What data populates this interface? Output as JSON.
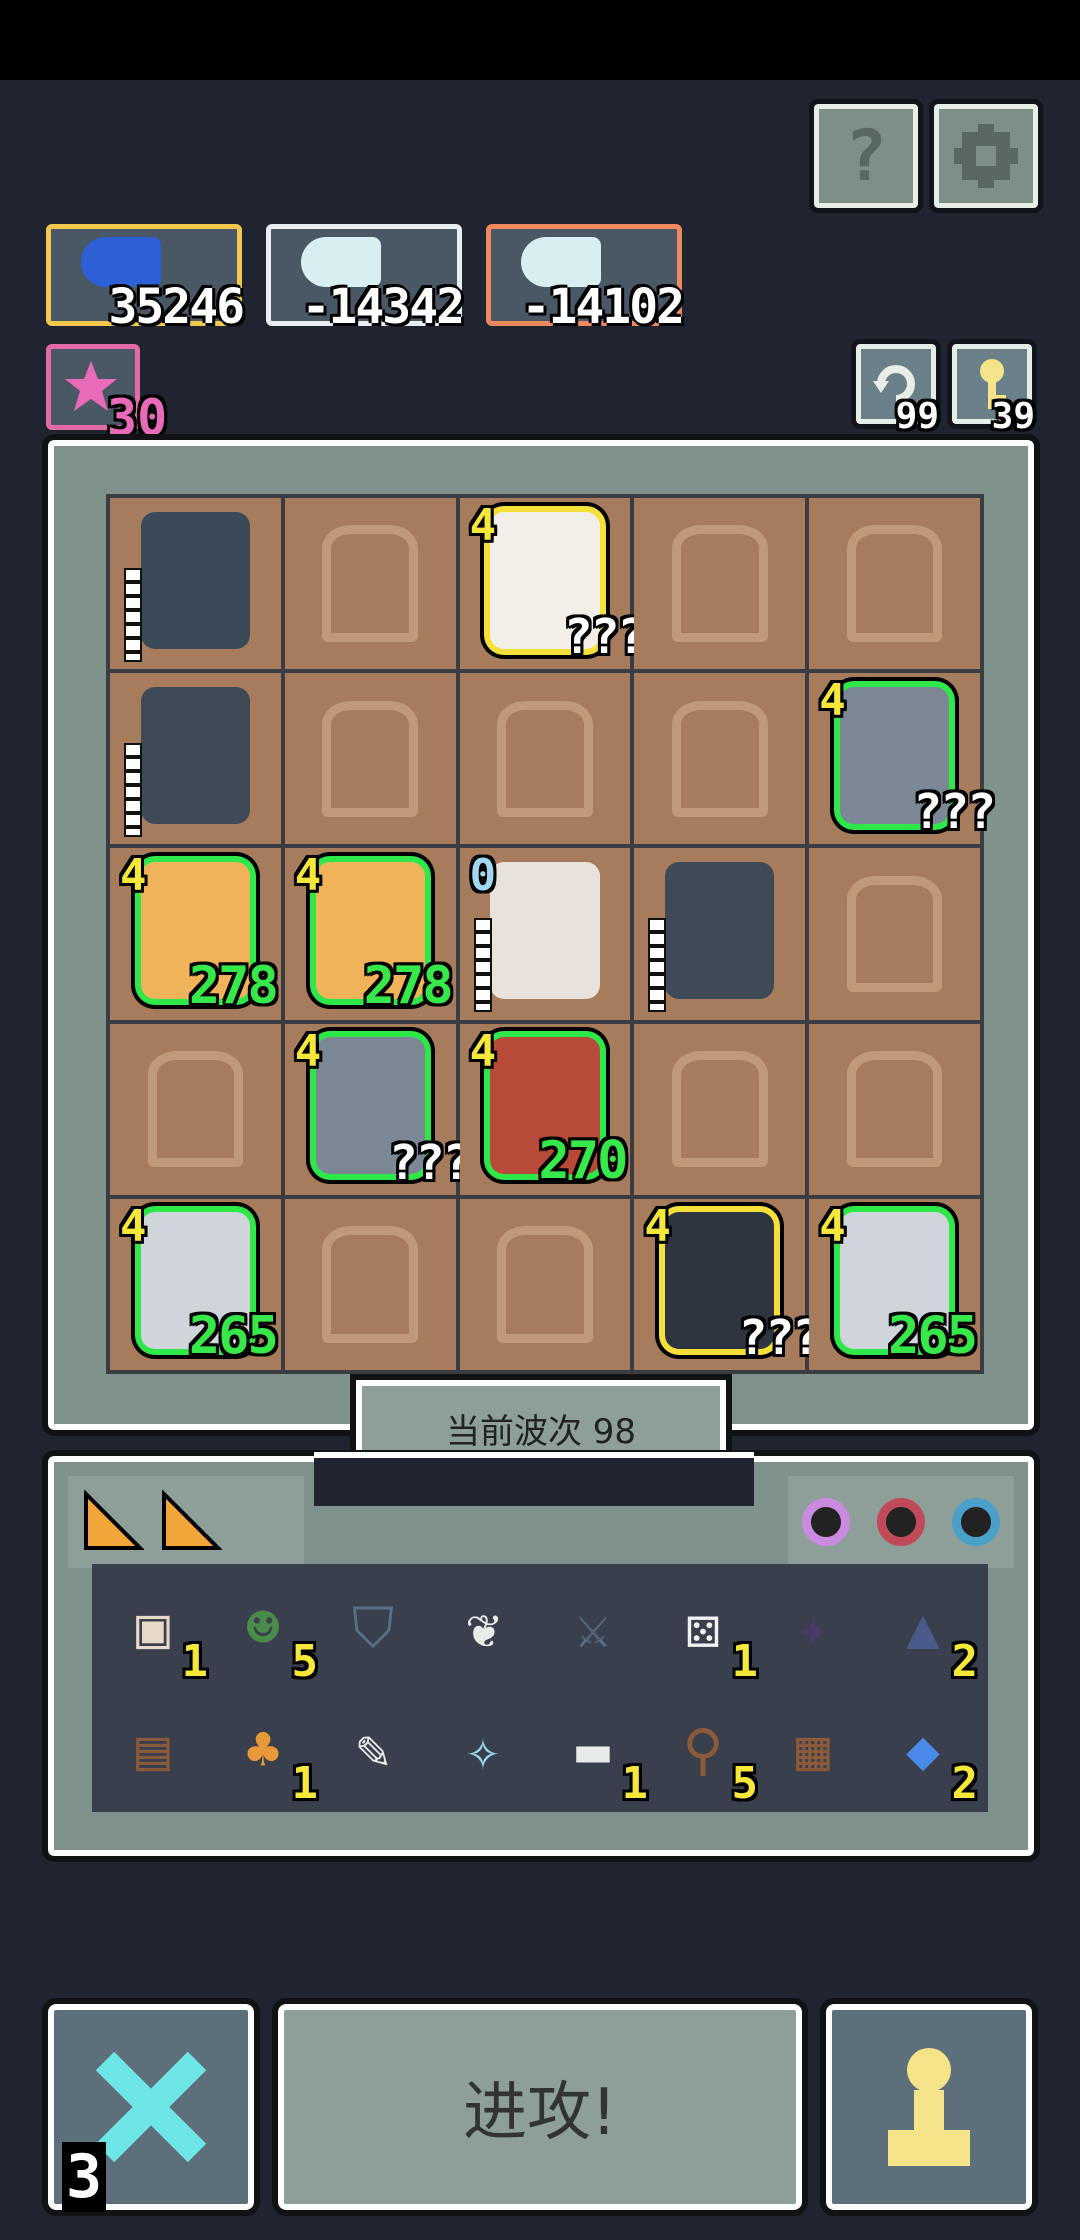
{
  "top_buttons": {
    "help_icon": "?",
    "settings_icon": "gear"
  },
  "resources": [
    {
      "name": "blue-fish",
      "value": "35246",
      "border": "#f2c94c"
    },
    {
      "name": "angel-a",
      "value": "-14342",
      "border": "#e8eef0"
    },
    {
      "name": "angel-b",
      "value": "-14102",
      "border": "#f08a5d"
    }
  ],
  "star_count": "30",
  "refresh_count": "99",
  "key_count": "39",
  "board": {
    "rows": [
      [
        {
          "unit": "samurai",
          "ladder": true
        },
        {},
        {
          "unit": "priestess",
          "level": "4",
          "hp": "???",
          "hp_color": "white",
          "glow": "#f5e03a"
        },
        {},
        {}
      ],
      [
        {
          "unit": "statue",
          "ladder": true
        },
        {},
        {},
        {},
        {
          "unit": "knight-shield",
          "level": "4",
          "hp": "???",
          "hp_color": "white",
          "glow": "#2ee84a"
        }
      ],
      [
        {
          "unit": "golem",
          "level": "4",
          "hp": "278",
          "hp_color": "green",
          "glow": "#2ee84a"
        },
        {
          "unit": "golem",
          "level": "4",
          "hp": "278",
          "hp_color": "green",
          "glow": "#2ee84a"
        },
        {
          "unit": "elder",
          "level": "0",
          "ladder": true
        },
        {
          "unit": "statue",
          "ladder": true
        },
        {}
      ],
      [
        {},
        {
          "unit": "knight-shield",
          "level": "4",
          "hp": "???",
          "hp_color": "white",
          "glow": "#2ee84a"
        },
        {
          "unit": "bandit",
          "level": "4",
          "hp": "270",
          "hp_color": "green",
          "glow": "#2ee84a"
        },
        {},
        {}
      ],
      [
        {
          "unit": "knight-armor",
          "level": "4",
          "hp": "265",
          "hp_color": "green",
          "glow": "#2ee84a"
        },
        {},
        {},
        {
          "unit": "dark-knight",
          "level": "4",
          "hp": "???",
          "hp_color": "white",
          "glow": "#f5e03a"
        },
        {
          "unit": "knight-armor",
          "level": "4",
          "hp": "265",
          "hp_color": "green",
          "glow": "#2ee84a"
        }
      ]
    ]
  },
  "wave_label": "当前波次 98",
  "inventory": {
    "cheese_slices": 2,
    "orbs": [
      "#c98ae0",
      "#c04a5a",
      "#4aa0c8"
    ],
    "items": [
      {
        "icon": "potion-jar",
        "count": "1"
      },
      {
        "icon": "goblin",
        "count": "5"
      },
      {
        "icon": "shield",
        "count": ""
      },
      {
        "icon": "wing",
        "count": ""
      },
      {
        "icon": "sword",
        "count": ""
      },
      {
        "icon": "dice",
        "count": "1"
      },
      {
        "icon": "bat",
        "count": ""
      },
      {
        "icon": "tree",
        "count": "2"
      },
      {
        "icon": "chest",
        "count": ""
      },
      {
        "icon": "bell",
        "count": "1"
      },
      {
        "icon": "feather-blade",
        "count": ""
      },
      {
        "icon": "crystal",
        "count": ""
      },
      {
        "icon": "anvil",
        "count": "1"
      },
      {
        "icon": "telescope",
        "count": "5"
      },
      {
        "icon": "spike-trap",
        "count": ""
      },
      {
        "icon": "fish",
        "count": "2"
      }
    ]
  },
  "attack_label": "进攻!",
  "swords_count": "3"
}
